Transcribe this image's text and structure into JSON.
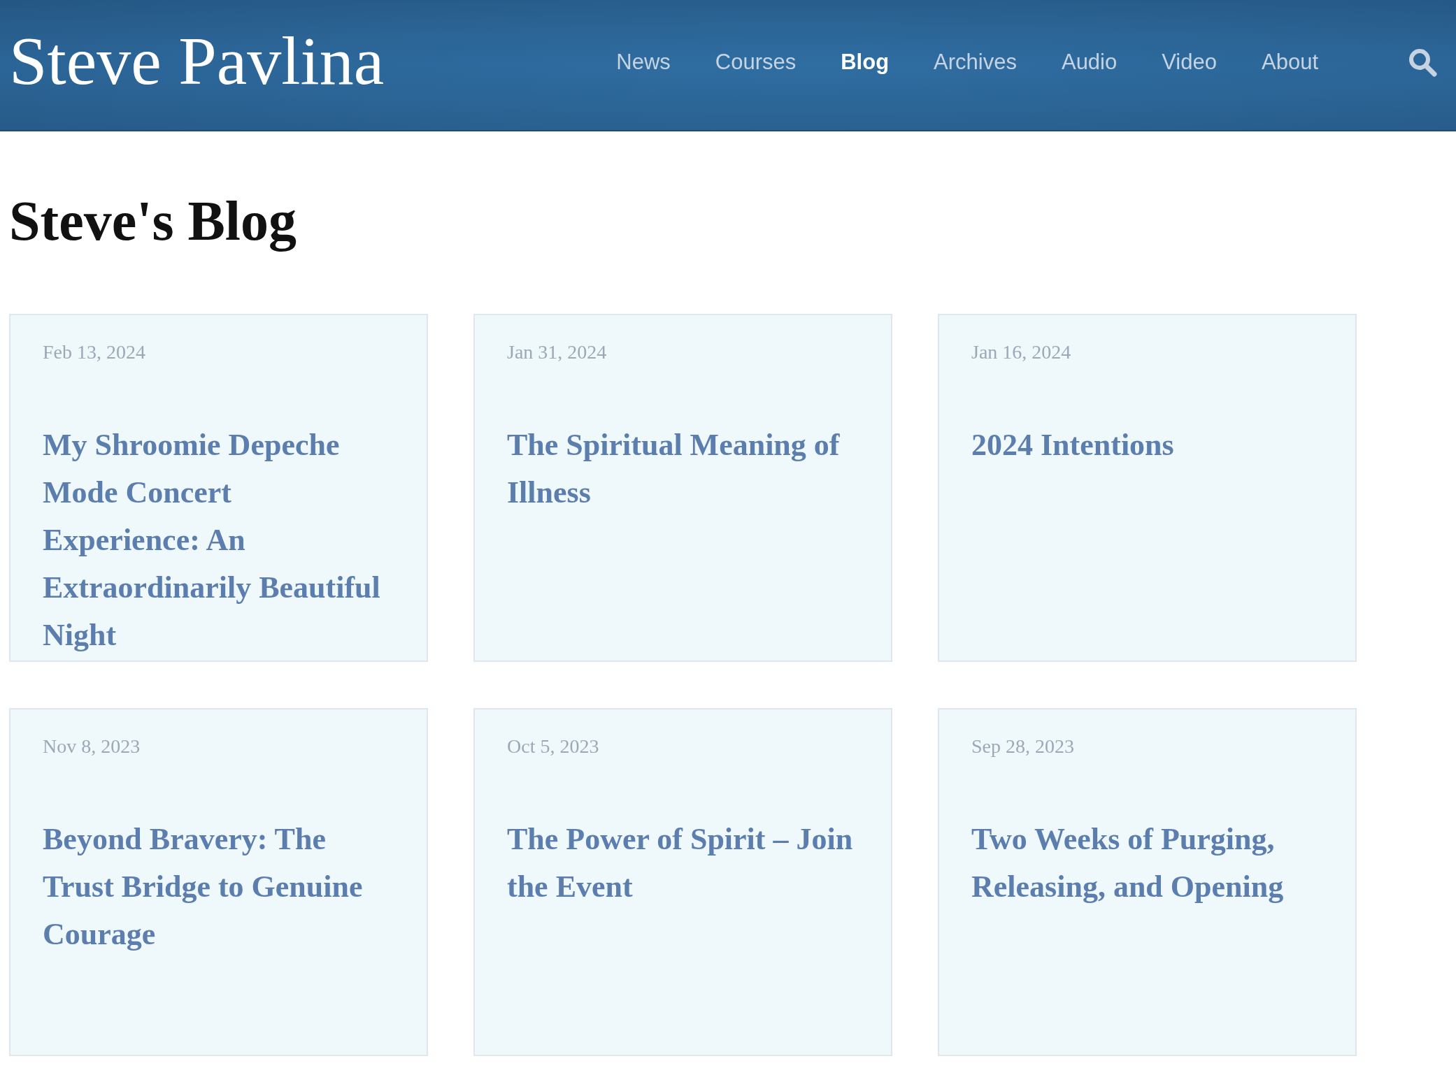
{
  "header": {
    "logo": "Steve Pavlina",
    "nav": [
      {
        "label": "News",
        "selected": false
      },
      {
        "label": "Courses",
        "selected": false
      },
      {
        "label": "Blog",
        "selected": true
      },
      {
        "label": "Archives",
        "selected": false
      },
      {
        "label": "Audio",
        "selected": false
      },
      {
        "label": "Video",
        "selected": false
      },
      {
        "label": "About",
        "selected": false
      }
    ]
  },
  "page_title": "Steve's Blog",
  "posts": [
    {
      "date": "Feb 13, 2024",
      "title": "My Shroomie Depeche Mode Concert Experience: An Extraordinarily Beautiful Night"
    },
    {
      "date": "Jan 31, 2024",
      "title": "The Spiritual Meaning of Illness"
    },
    {
      "date": "Jan 16, 2024",
      "title": "2024 Intentions"
    },
    {
      "date": "Nov 8, 2023",
      "title": "Beyond Bravery: The Trust Bridge to Genuine Courage"
    },
    {
      "date": "Oct 5, 2023",
      "title": "The Power of Spirit – Join the Event"
    },
    {
      "date": "Sep 28, 2023",
      "title": "Two Weeks of Purging, Releasing, and Opening"
    }
  ]
}
